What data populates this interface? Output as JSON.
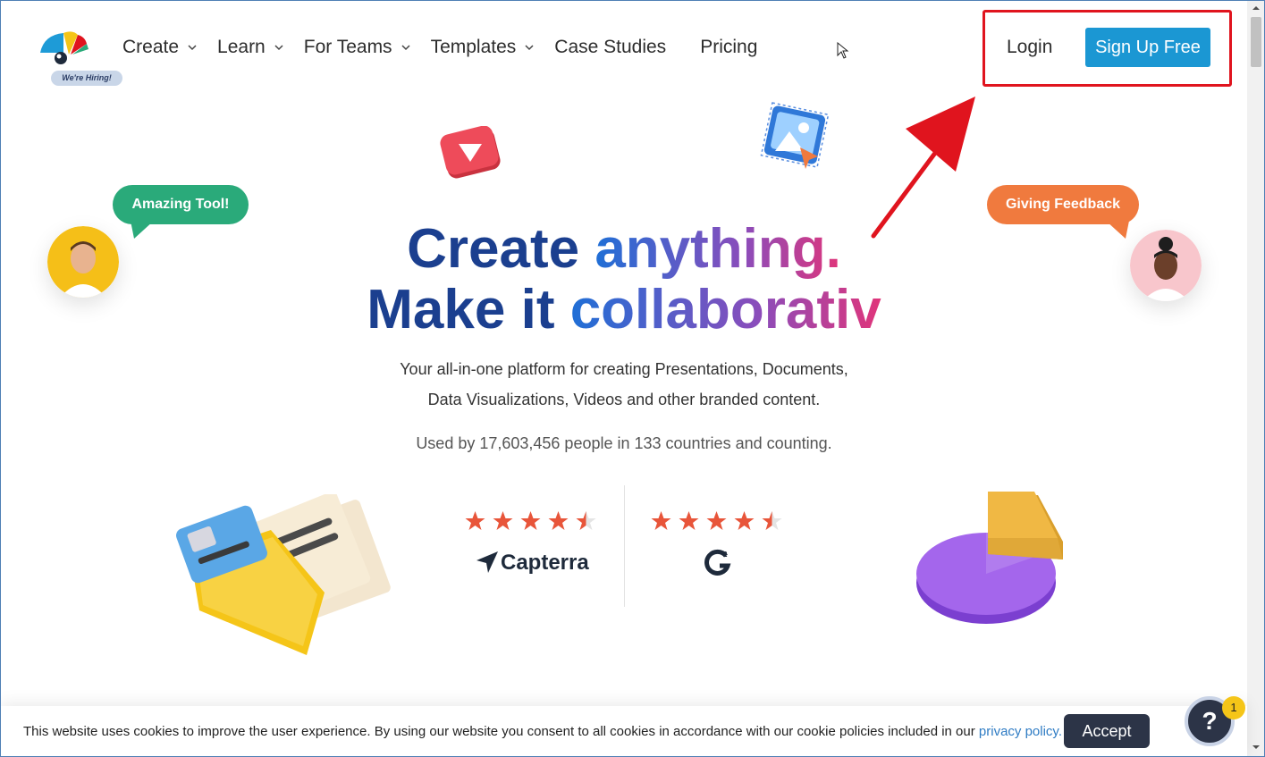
{
  "nav": {
    "hiring_label": "We're Hiring!",
    "items": [
      {
        "label": "Create",
        "has_dropdown": true
      },
      {
        "label": "Learn",
        "has_dropdown": true
      },
      {
        "label": "For Teams",
        "has_dropdown": true
      },
      {
        "label": "Templates",
        "has_dropdown": true
      },
      {
        "label": "Case Studies",
        "has_dropdown": false
      },
      {
        "label": "Pricing",
        "has_dropdown": false
      }
    ],
    "login_label": "Login",
    "signup_label": "Sign Up Free"
  },
  "hero": {
    "bubble_left": "Amazing Tool!",
    "bubble_right": "Giving Feedback",
    "headline_1a": "Create ",
    "headline_1b": "anything.",
    "headline_2a": "Make it ",
    "headline_2b": "collaborativ",
    "sub_line_1": "Your all-in-one platform for creating Presentations, Documents,",
    "sub_line_2": "Data Visualizations, Videos and other branded content.",
    "used_by": "Used by 17,603,456 people in 133 countries and counting."
  },
  "ratings": [
    {
      "brand": "Capterra",
      "stars": 4.5
    },
    {
      "brand": "G2",
      "stars": 4.5
    }
  ],
  "cookie": {
    "text": "This website uses cookies to improve the user experience. By using our website you consent to all cookies in accordance with our cookie policies included in our ",
    "link": "privacy policy.",
    "accept_label": "Accept"
  },
  "help": {
    "label": "?",
    "badge": "1"
  },
  "colors": {
    "accent": "#1b97d3",
    "highlight_box": "#e0141e",
    "headline_dark": "#1b3f8f",
    "star": "#e8553a",
    "accept_bg": "#2c3447"
  }
}
